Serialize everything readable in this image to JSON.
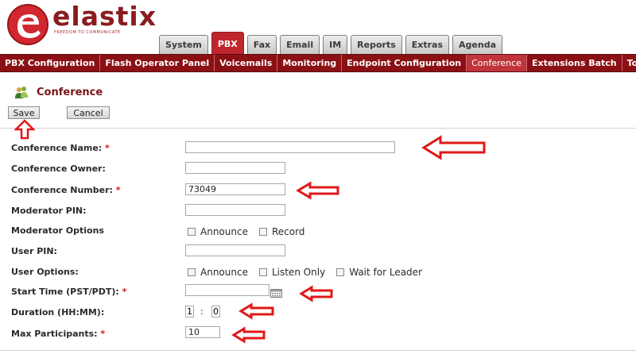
{
  "brand": {
    "name": "elastix",
    "tagline": "FREEDOM TO COMMUNICATE"
  },
  "main_tabs": [
    "System",
    "PBX",
    "Fax",
    "Email",
    "IM",
    "Reports",
    "Extras",
    "Agenda"
  ],
  "active_main_tab": "PBX",
  "sub_nav": [
    "PBX Configuration",
    "Flash Operator Panel",
    "Voicemails",
    "Monitoring",
    "Endpoint Configuration",
    "Conference",
    "Extensions Batch",
    "Tools"
  ],
  "active_sub_nav": "Conference",
  "page_title": "Conference",
  "buttons": {
    "save": "Save",
    "cancel": "Cancel"
  },
  "form": {
    "conference_name": {
      "label": "Conference Name:",
      "required": "*",
      "value": ""
    },
    "conference_owner": {
      "label": "Conference Owner:",
      "value": ""
    },
    "conference_number": {
      "label": "Conference Number:",
      "required": "*",
      "value": "73049"
    },
    "moderator_pin": {
      "label": "Moderator PIN:",
      "value": ""
    },
    "moderator_options": {
      "label": "Moderator Options",
      "options": [
        "Announce",
        "Record"
      ]
    },
    "user_pin": {
      "label": "User PIN:",
      "value": ""
    },
    "user_options": {
      "label": "User Options:",
      "options": [
        "Announce",
        "Listen Only",
        "Wait for Leader"
      ]
    },
    "start_time": {
      "label": "Start Time (PST/PDT):",
      "required": "*",
      "value": ""
    },
    "duration": {
      "label": "Duration (HH:MM):",
      "hours": "1",
      "separator": ":",
      "minutes": "0"
    },
    "max_participants": {
      "label": "Max Participants:",
      "required": "*",
      "value": "10"
    }
  },
  "colors": {
    "brand": "#8b1014",
    "active_tab": "#c0272d",
    "annotation_arrow": "#e01818"
  }
}
